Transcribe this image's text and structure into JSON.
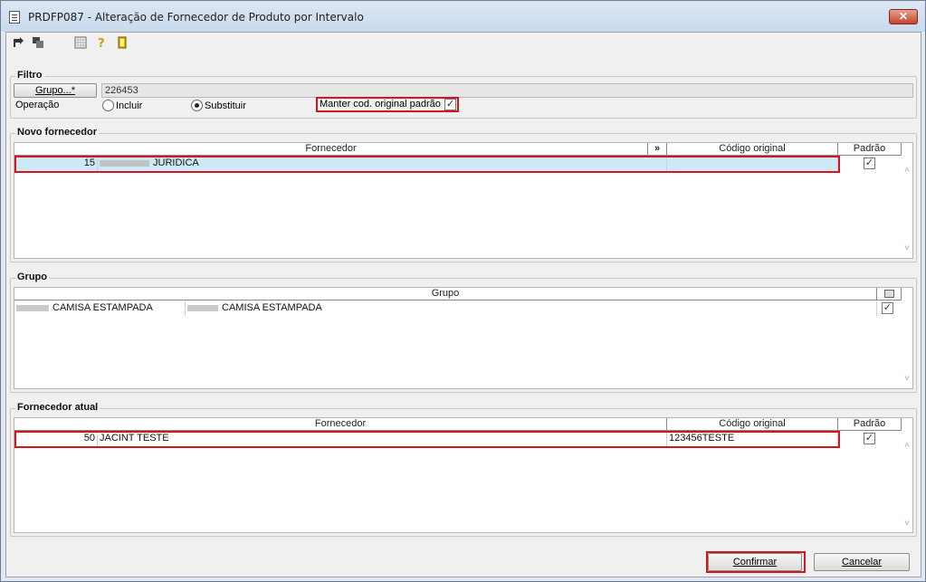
{
  "window": {
    "title": "PRDFP087 - Alteração de Fornecedor de Produto por Intervalo",
    "close_glyph": "✕"
  },
  "toolbar": {
    "icons": [
      "arrow-icon",
      "copy-icon",
      "calendar-icon",
      "help-icon",
      "exit-door-icon"
    ]
  },
  "filtro": {
    "title": "Filtro",
    "grupo_button": "Grupo...*",
    "grupo_value": "226453",
    "operacao_label": "Operação",
    "incluir_label": "Incluir",
    "substituir_label": "Substituir",
    "operacao_selected": "Substituir",
    "manter_label": "Manter cod. original padrão",
    "manter_checked": true
  },
  "novo_fornecedor": {
    "title": "Novo fornecedor",
    "columns": [
      "Fornecedor",
      "»",
      "Código original",
      "Padrão"
    ],
    "rows": [
      {
        "num": "15",
        "name": "JURIDICA",
        "codigo": "",
        "padrao": true
      }
    ]
  },
  "grupo": {
    "title": "Grupo",
    "column": "Grupo",
    "rows": [
      {
        "col1": "CAMISA ESTAMPADA",
        "col2": "CAMISA ESTAMPADA",
        "padrao": true
      }
    ]
  },
  "fornecedor_atual": {
    "title": "Fornecedor atual",
    "columns": [
      "Fornecedor",
      "Código original",
      "Padrão"
    ],
    "rows": [
      {
        "num": "50",
        "name": "JACINT TESTE",
        "codigo": "123456TESTE",
        "padrao": true
      }
    ]
  },
  "footer": {
    "confirmar": "Confirmar",
    "cancelar": "Cancelar"
  },
  "colors": {
    "highlight": "#d6141e",
    "selected_row": "#cde8f6"
  }
}
